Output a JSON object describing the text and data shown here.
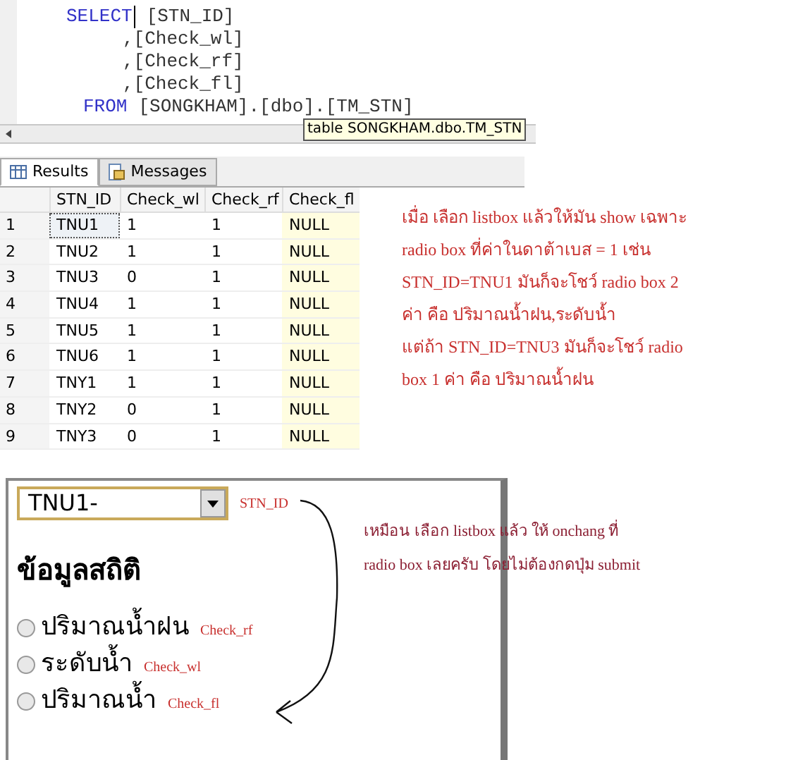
{
  "editor": {
    "lines": [
      {
        "kind": "select",
        "keyword": "SELECT",
        "code": "[STN_ID]"
      },
      {
        "kind": "column",
        "code": ",[Check_wl]"
      },
      {
        "kind": "column",
        "code": ",[Check_rf]"
      },
      {
        "kind": "column",
        "code": ",[Check_fl]"
      },
      {
        "kind": "from",
        "keyword": "FROM",
        "code": "[SONGKHAM].[dbo].[TM_STN]"
      }
    ],
    "tooltip": "table SONGKHAM.dbo.TM_STN"
  },
  "result_tabs": [
    {
      "label": "Results",
      "selected": true
    },
    {
      "label": "Messages",
      "selected": false
    }
  ],
  "grid": {
    "columns": [
      "STN_ID",
      "Check_wl",
      "Check_rf",
      "Check_fl"
    ],
    "rows": [
      {
        "number": "1",
        "cells": [
          "TNU1",
          "1",
          "1",
          "NULL"
        ],
        "focused": true
      },
      {
        "number": "2",
        "cells": [
          "TNU2",
          "1",
          "1",
          "NULL"
        ],
        "focused": false
      },
      {
        "number": "3",
        "cells": [
          "TNU3",
          "0",
          "1",
          "NULL"
        ],
        "focused": false
      },
      {
        "number": "4",
        "cells": [
          "TNU4",
          "1",
          "1",
          "NULL"
        ],
        "focused": false
      },
      {
        "number": "5",
        "cells": [
          "TNU5",
          "1",
          "1",
          "NULL"
        ],
        "focused": false
      },
      {
        "number": "6",
        "cells": [
          "TNU6",
          "1",
          "1",
          "NULL"
        ],
        "focused": false
      },
      {
        "number": "7",
        "cells": [
          "TNY1",
          "1",
          "1",
          "NULL"
        ],
        "focused": false
      },
      {
        "number": "8",
        "cells": [
          "TNY2",
          "0",
          "1",
          "NULL"
        ],
        "focused": false
      },
      {
        "number": "9",
        "cells": [
          "TNY3",
          "0",
          "1",
          "NULL"
        ],
        "focused": false
      }
    ]
  },
  "note_1": [
    "เมื่อ เลือก listbox แล้วให้มัน show เฉพาะ",
    "radio box ที่ค่าในดาต้าเบส = 1 เช่น",
    "STN_ID=TNU1 มันก็จะโชว์ radio box 2",
    "ค่า คือ ปริมาณน้ำฝน,ระดับน้ำ",
    "แต่ถ้า STN_ID=TNU3 มันก็จะโชว์ radio",
    "box 1 ค่า คือ ปริมาณน้ำฝน"
  ],
  "form": {
    "dropdown": {
      "value": "TNU1-"
    },
    "dropdown_label": "STN_ID",
    "heading": "ข้อมูลสถิติ",
    "radios": [
      {
        "label": "ปริมาณน้ำฝน",
        "tag": "Check_rf",
        "checked": false
      },
      {
        "label": "ระดับน้ำ",
        "tag": "Check_wl",
        "checked": false
      },
      {
        "label": "ปริมาณน้ำ",
        "tag": "Check_fl",
        "checked": false
      }
    ]
  },
  "note_2": [
    "เหมือน เลือก listbox แล้ว ให้ onchang ที่",
    "radio box เลยครับ โดยไม่ต้องกดปุ่ม submit"
  ]
}
